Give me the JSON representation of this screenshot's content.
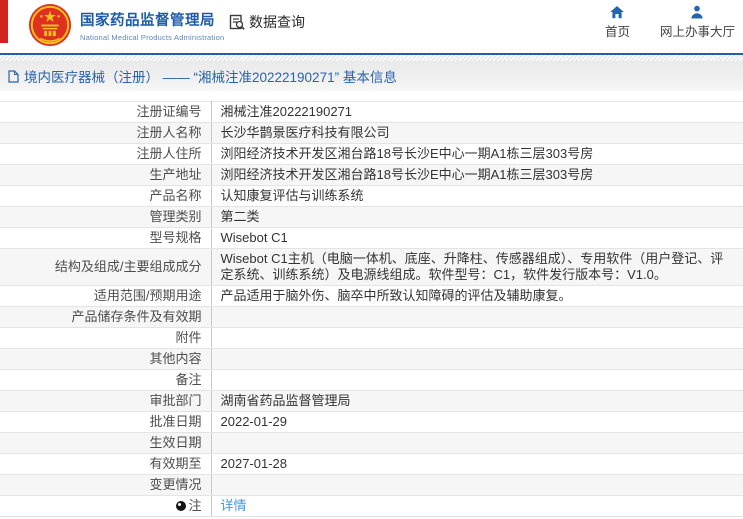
{
  "header": {
    "agency_name_zh": "国家药品监督管理局",
    "agency_name_en": "National Medical Products Administration",
    "section_title": "数据查询",
    "nav": [
      {
        "label": "首页",
        "icon": "home-icon"
      },
      {
        "label": "网上办事大厅",
        "icon": "user-icon"
      }
    ]
  },
  "breadcrumb": {
    "text": "境内医疗器械（注册） —— “湘械注准20222190271” 基本信息"
  },
  "table": {
    "rows": [
      {
        "label": "注册证编号",
        "value": "湘械注准20222190271"
      },
      {
        "label": "注册人名称",
        "value": "长沙华鹊景医疗科技有限公司"
      },
      {
        "label": "注册人住所",
        "value": "浏阳经济技术开发区湘台路18号长沙E中心一期A1栋三层303号房"
      },
      {
        "label": "生产地址",
        "value": "浏阳经济技术开发区湘台路18号长沙E中心一期A1栋三层303号房"
      },
      {
        "label": "产品名称",
        "value": "认知康复评估与训练系统"
      },
      {
        "label": "管理类别",
        "value": "第二类"
      },
      {
        "label": "型号规格",
        "value": "Wisebot C1"
      },
      {
        "label": "结构及组成/主要组成成分",
        "value": "Wisebot C1主机（电脑一体机、底座、升降柱、传感器组成）、专用软件（用户登记、评定系统、训练系统）及电源线组成。软件型号：C1，软件发行版本号：V1.0。"
      },
      {
        "label": "适用范围/预期用途",
        "value": "产品适用于脑外伤、脑卒中所致认知障碍的评估及辅助康复。"
      },
      {
        "label": "产品储存条件及有效期",
        "value": ""
      },
      {
        "label": "附件",
        "value": ""
      },
      {
        "label": "其他内容",
        "value": ""
      },
      {
        "label": "备注",
        "value": ""
      },
      {
        "label": "审批部门",
        "value": "湖南省药品监督管理局"
      },
      {
        "label": "批准日期",
        "value": "2022-01-29"
      },
      {
        "label": "生效日期",
        "value": ""
      },
      {
        "label": "有效期至",
        "value": "2027-01-28"
      },
      {
        "label": "变更情况",
        "value": ""
      },
      {
        "label": "注",
        "value": "详情",
        "link": true,
        "label_icon": "note-icon"
      }
    ]
  },
  "colors": {
    "brand_blue": "#1e5ba8",
    "nav_icon_blue": "#2465ae",
    "header_rule_blue": "#1b62ab",
    "red_accent": "#d0251c",
    "link_blue": "#4a95d9",
    "breadcrumb_text": "#2a63a9",
    "row_alt_bg": "#f6f6f6",
    "table_border": "#e4e4e4"
  }
}
